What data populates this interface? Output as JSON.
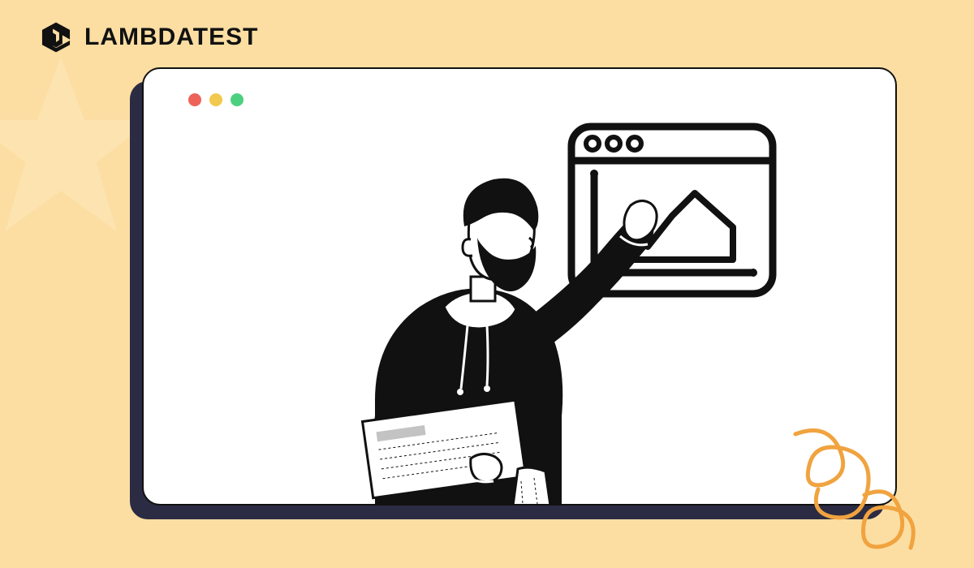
{
  "brand": {
    "name": "LAMBDATEST"
  },
  "colors": {
    "background": "#fcdea2",
    "traffic_red": "#ed6259",
    "traffic_yellow": "#f2c94c",
    "traffic_green": "#4cd080",
    "shadow": "#2b2c43",
    "squiggle": "#f0a33f"
  },
  "icons": {
    "logo": "lambdatest-logo-icon",
    "star": "star-icon",
    "browser_chart": "browser-chart-icon",
    "person": "person-holding-folder-icon",
    "squiggle": "squiggle-decoration-icon"
  }
}
